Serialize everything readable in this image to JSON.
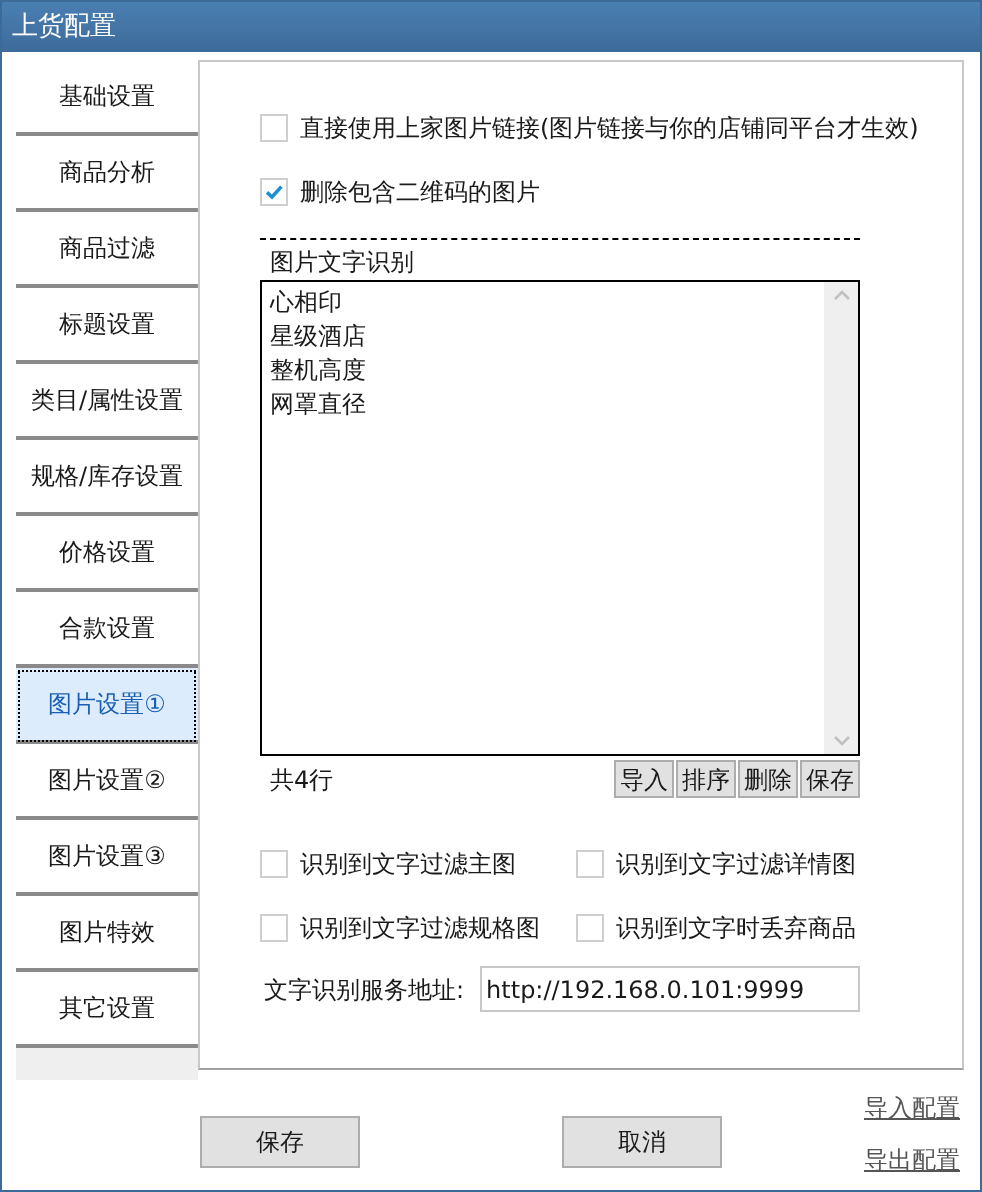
{
  "window": {
    "title": "上货配置"
  },
  "sidebar": {
    "items": [
      {
        "label": "基础设置",
        "selected": false
      },
      {
        "label": "商品分析",
        "selected": false
      },
      {
        "label": "商品过滤",
        "selected": false
      },
      {
        "label": "标题设置",
        "selected": false
      },
      {
        "label": "类目/属性设置",
        "selected": false
      },
      {
        "label": "规格/库存设置",
        "selected": false
      },
      {
        "label": "价格设置",
        "selected": false
      },
      {
        "label": "合款设置",
        "selected": false
      },
      {
        "label": "图片设置①",
        "selected": true
      },
      {
        "label": "图片设置②",
        "selected": false
      },
      {
        "label": "图片设置③",
        "selected": false
      },
      {
        "label": "图片特效",
        "selected": false
      },
      {
        "label": "其它设置",
        "selected": false
      }
    ]
  },
  "options": [
    {
      "label": "直接使用上家图片链接(图片链接与你的店铺同平台才生效)",
      "checked": false
    },
    {
      "label": "删除包含二维码的图片",
      "checked": true
    }
  ],
  "ocr": {
    "title": "图片文字识别",
    "lines": [
      "心相印",
      "星级酒店",
      "整机高度",
      "网罩直径"
    ],
    "count": "共4行",
    "buttons": [
      "导入",
      "排序",
      "删除",
      "保存"
    ],
    "filters": [
      {
        "label": "识别到文字过滤主图",
        "checked": false
      },
      {
        "label": "识别到文字过滤详情图",
        "checked": false
      },
      {
        "label": "识别到文字过滤规格图",
        "checked": false
      },
      {
        "label": "识别到文字时丢弃商品",
        "checked": false
      }
    ],
    "service_label": "文字识别服务地址:",
    "service_value": "http://192.168.0.101:9999"
  },
  "footer": {
    "buttons": [
      "保存",
      "取消"
    ],
    "links": [
      "导入配置",
      "导出配置"
    ]
  }
}
